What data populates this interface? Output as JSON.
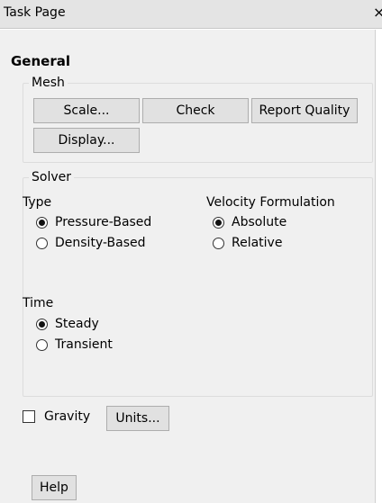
{
  "window": {
    "title": "Task Page",
    "close_glyph": "×"
  },
  "general": {
    "heading": "General"
  },
  "mesh": {
    "legend": "Mesh",
    "scale_label": "Scale...",
    "check_label": "Check",
    "report_quality_label": "Report Quality",
    "display_label": "Display..."
  },
  "solver": {
    "legend": "Solver",
    "type_label": "Type",
    "type_options": [
      "Pressure-Based",
      "Density-Based"
    ],
    "type_selected": "Pressure-Based",
    "velocity_label": "Velocity Formulation",
    "velocity_options": [
      "Absolute",
      "Relative"
    ],
    "velocity_selected": "Absolute",
    "time_label": "Time",
    "time_options": [
      "Steady",
      "Transient"
    ],
    "time_selected": "Steady"
  },
  "gravity": {
    "label": "Gravity",
    "checked": false
  },
  "units_label": "Units...",
  "help_label": "Help",
  "colors": {
    "panel_background": "#f0f0f0",
    "button_background": "#e1e1e1",
    "button_border": "#adadad"
  }
}
